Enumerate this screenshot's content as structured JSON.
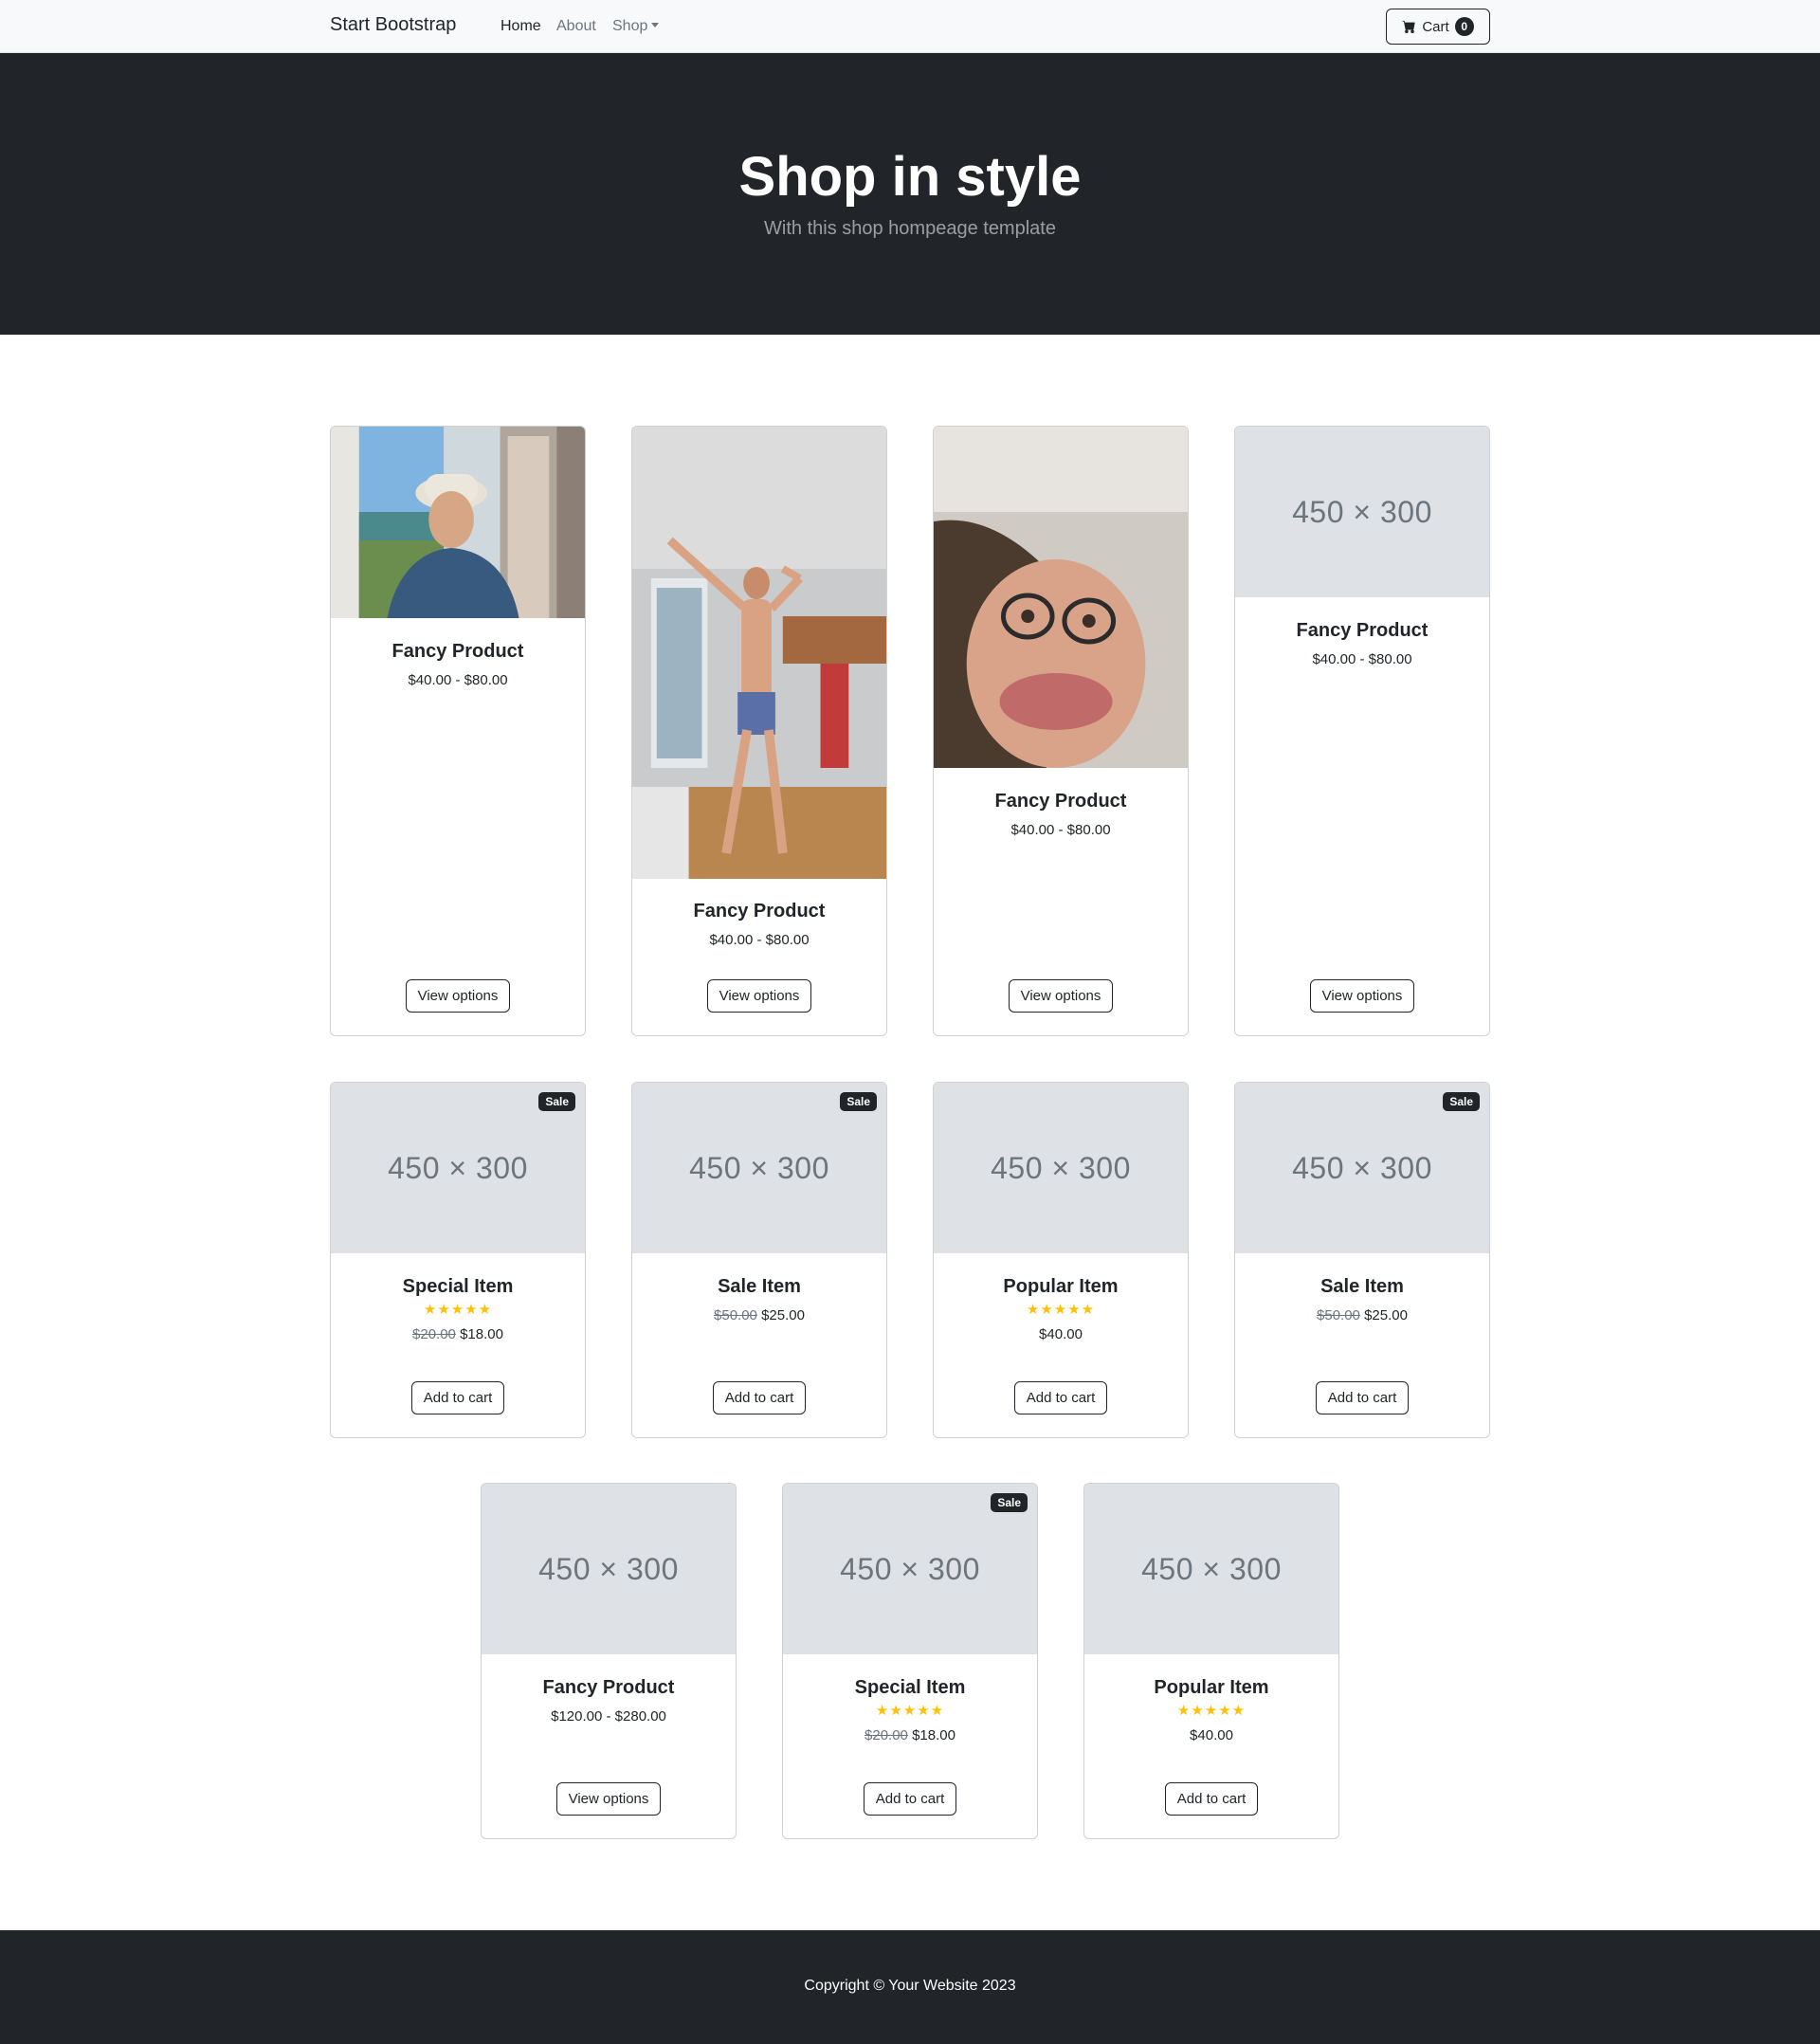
{
  "navbar": {
    "brand": "Start Bootstrap",
    "links": [
      {
        "label": "Home",
        "active": true
      },
      {
        "label": "About",
        "active": false
      },
      {
        "label": "Shop",
        "active": false
      }
    ],
    "cart": {
      "label": "Cart",
      "count": "0"
    }
  },
  "hero": {
    "title": "Shop in style",
    "subtitle": "With this shop hompeage template"
  },
  "colors": {
    "dark": "#212529",
    "placeholder_bg": "#dee2e6",
    "star": "#ffc107",
    "muted": "#6c757d"
  },
  "products": [
    {
      "name": "Fancy Product",
      "price": "$40.00 - $80.00",
      "button": "View options",
      "image": "photo-person-hat-window"
    },
    {
      "name": "Fancy Product",
      "price": "$40.00 - $80.00",
      "button": "View options",
      "image": "photo-person-posing-kitchen"
    },
    {
      "name": "Fancy Product",
      "price": "$40.00 - $80.00",
      "button": "View options",
      "image": "photo-person-face-closeup"
    },
    {
      "name": "Fancy Product",
      "price": "$40.00 - $80.00",
      "button": "View options",
      "image": "450 × 300"
    },
    {
      "name": "Special Item",
      "sale": "Sale",
      "rating": 5,
      "old_price": "$20.00",
      "price": "$18.00",
      "button": "Add to cart",
      "image": "450 × 300"
    },
    {
      "name": "Sale Item",
      "sale": "Sale",
      "old_price": "$50.00",
      "price": "$25.00",
      "button": "Add to cart",
      "image": "450 × 300"
    },
    {
      "name": "Popular Item",
      "rating": 5,
      "price": "$40.00",
      "button": "Add to cart",
      "image": "450 × 300"
    },
    {
      "name": "Sale Item",
      "sale": "Sale",
      "old_price": "$50.00",
      "price": "$25.00",
      "button": "Add to cart",
      "image": "450 × 300"
    },
    {
      "name": "Fancy Product",
      "price": "$120.00 - $280.00",
      "button": "View options",
      "image": "450 × 300"
    },
    {
      "name": "Special Item",
      "sale": "Sale",
      "rating": 5,
      "old_price": "$20.00",
      "price": "$18.00",
      "button": "Add to cart",
      "image": "450 × 300"
    },
    {
      "name": "Popular Item",
      "rating": 5,
      "price": "$40.00",
      "button": "Add to cart",
      "image": "450 × 300"
    }
  ],
  "footer": {
    "copyright": "Copyright © Your Website 2023"
  }
}
